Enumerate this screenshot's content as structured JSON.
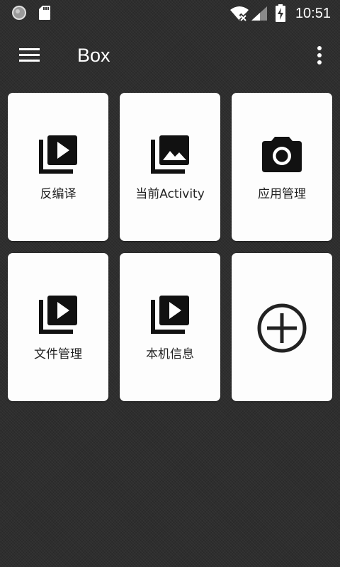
{
  "status_bar": {
    "time": "10:51",
    "icons": [
      "notification-circle-icon",
      "sd-card-icon",
      "wifi-off-icon",
      "signal-icon",
      "battery-charging-icon"
    ]
  },
  "app_bar": {
    "title": "Box",
    "menu_icon": "hamburger-menu-icon",
    "overflow_icon": "more-vert-icon"
  },
  "tiles": [
    {
      "label": "反编译",
      "icon": "video-library-icon"
    },
    {
      "label": "当前Activity",
      "icon": "photo-library-icon"
    },
    {
      "label": "应用管理",
      "icon": "camera-icon"
    },
    {
      "label": "文件管理",
      "icon": "video-library-icon"
    },
    {
      "label": "本机信息",
      "icon": "video-library-icon"
    },
    {
      "label": "",
      "icon": "add-circle-icon"
    }
  ],
  "colors": {
    "background": "#2e2e2e",
    "card": "#fdfdfd",
    "text_on_dark": "#ffffff",
    "text_on_card": "#222222",
    "icon": "#111111"
  }
}
